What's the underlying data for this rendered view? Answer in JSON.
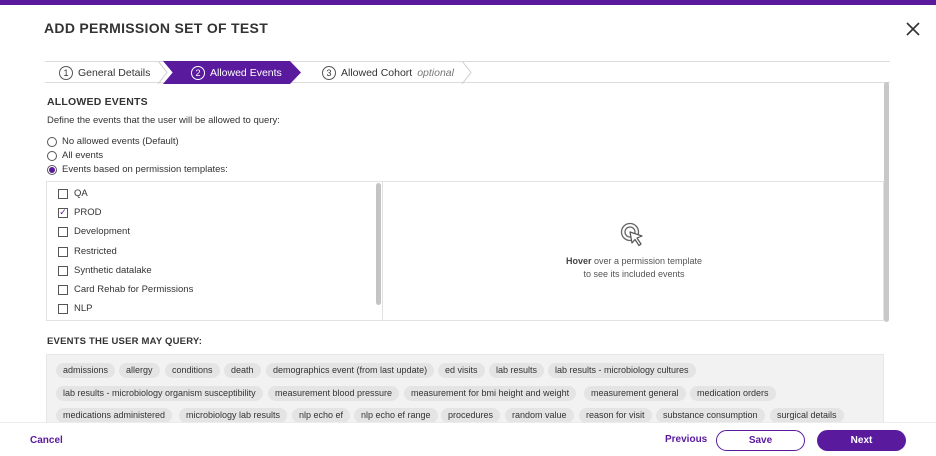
{
  "modal": {
    "title": "ADD PERMISSION SET OF TEST"
  },
  "stepper": {
    "steps": [
      {
        "number": "1",
        "label": "General Details"
      },
      {
        "number": "2",
        "label": "Allowed Events"
      },
      {
        "number": "3",
        "label": "Allowed Cohort",
        "note": "optional"
      }
    ],
    "active_step": 2
  },
  "allowed_events": {
    "title": "ALLOWED EVENTS",
    "description": "Define the events that the user will be allowed to query:",
    "options": [
      {
        "label": "No allowed events (Default)",
        "selected": false
      },
      {
        "label": "All events",
        "selected": false
      },
      {
        "label": "Events based on permission templates:",
        "selected": true
      }
    ]
  },
  "templates": {
    "items": [
      {
        "label": "QA",
        "checked": false
      },
      {
        "label": "PROD",
        "checked": true
      },
      {
        "label": "Development",
        "checked": false
      },
      {
        "label": "Restricted",
        "checked": false
      },
      {
        "label": "Synthetic datalake",
        "checked": false
      },
      {
        "label": "Card Rehab for Permissions",
        "checked": false
      },
      {
        "label": "NLP",
        "checked": false
      }
    ],
    "hover_hint_bold": "Hover",
    "hover_hint_line1": " over a permission template",
    "hover_hint_line2": "to see its included events",
    "hint_icon": "pointer-click-icon"
  },
  "queryable_events": {
    "title": "EVENTS THE USER MAY QUERY:",
    "chips": [
      "admissions",
      "allergy",
      "conditions",
      "death",
      "demographics event (from last update)",
      "ed visits",
      "lab results",
      "lab results - microbiology cultures",
      "lab results - microbiology organism susceptibility",
      "measurement blood pressure",
      "measurement for bmi height and weight",
      "measurement general",
      "medication orders",
      "medications administered",
      "microbiology lab results",
      "nlp echo ef",
      "nlp echo ef range",
      "procedures",
      "random value",
      "reason for visit",
      "substance consumption",
      "surgical details"
    ]
  },
  "footer": {
    "cancel": "Cancel",
    "previous": "Previous",
    "save": "Save",
    "next": "Next"
  },
  "colors": {
    "accent": "#5a1a9e"
  }
}
